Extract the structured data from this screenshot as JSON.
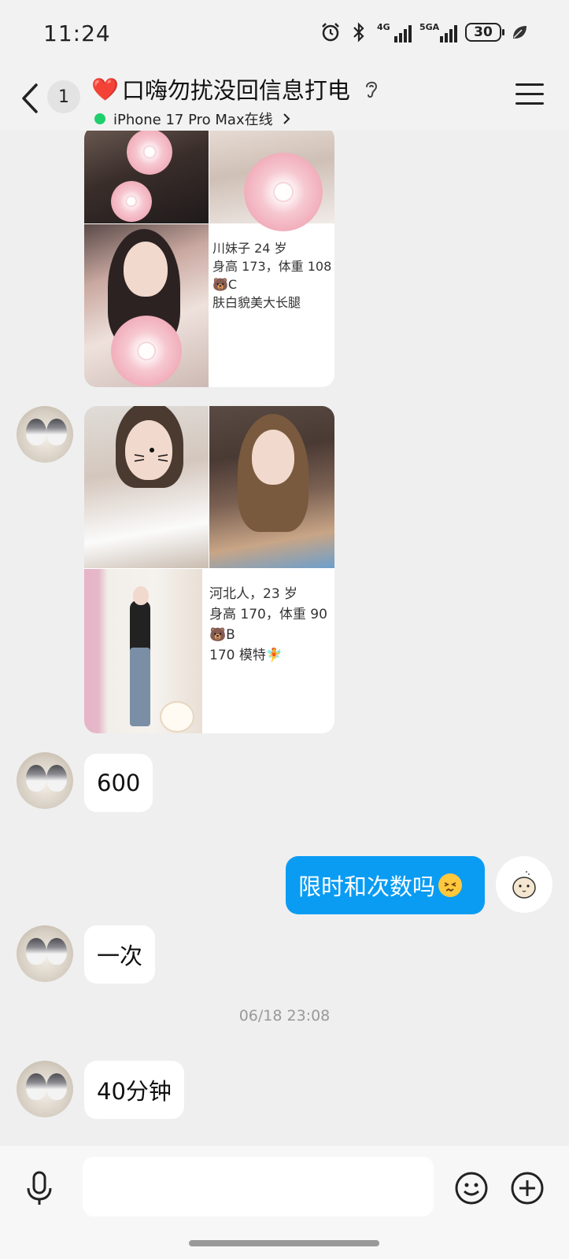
{
  "status_bar": {
    "time": "11:24",
    "network_1": "4G",
    "network_2": "5GA",
    "battery": "30",
    "icons": [
      "alarm-icon",
      "bluetooth-icon",
      "signal-icon",
      "signal-icon",
      "battery-icon",
      "leaf-icon"
    ]
  },
  "header": {
    "unread_count": "1",
    "title_heart": "❤️",
    "title": "口嗨勿扰没回信息打电",
    "device_status": "iPhone 17 Pro Max在线",
    "icons": [
      "back-icon",
      "ear-icon",
      "chevron-right-icon",
      "menu-icon"
    ]
  },
  "messages": [
    {
      "type": "card",
      "from": "other",
      "lines": [
        "川妹子 24 岁",
        "身高 173，体重 108",
        "🐻C",
        "肤白貌美大长腿"
      ]
    },
    {
      "type": "card",
      "from": "other",
      "lines": [
        "河北人，23 岁",
        "身高 170，体重 90",
        "🐻B",
        "170 模特🧚"
      ]
    },
    {
      "type": "text",
      "from": "other",
      "text": "600"
    },
    {
      "type": "text",
      "from": "me",
      "text": "限时和次数吗",
      "emoji": "😣"
    },
    {
      "type": "text",
      "from": "other",
      "text": "一次"
    },
    {
      "type": "time",
      "text": "06/18 23:08"
    },
    {
      "type": "text",
      "from": "other",
      "text": "40分钟"
    }
  ],
  "input_bar": {
    "placeholder": "",
    "icons": [
      "microphone-icon",
      "emoji-icon",
      "plus-icon"
    ]
  }
}
